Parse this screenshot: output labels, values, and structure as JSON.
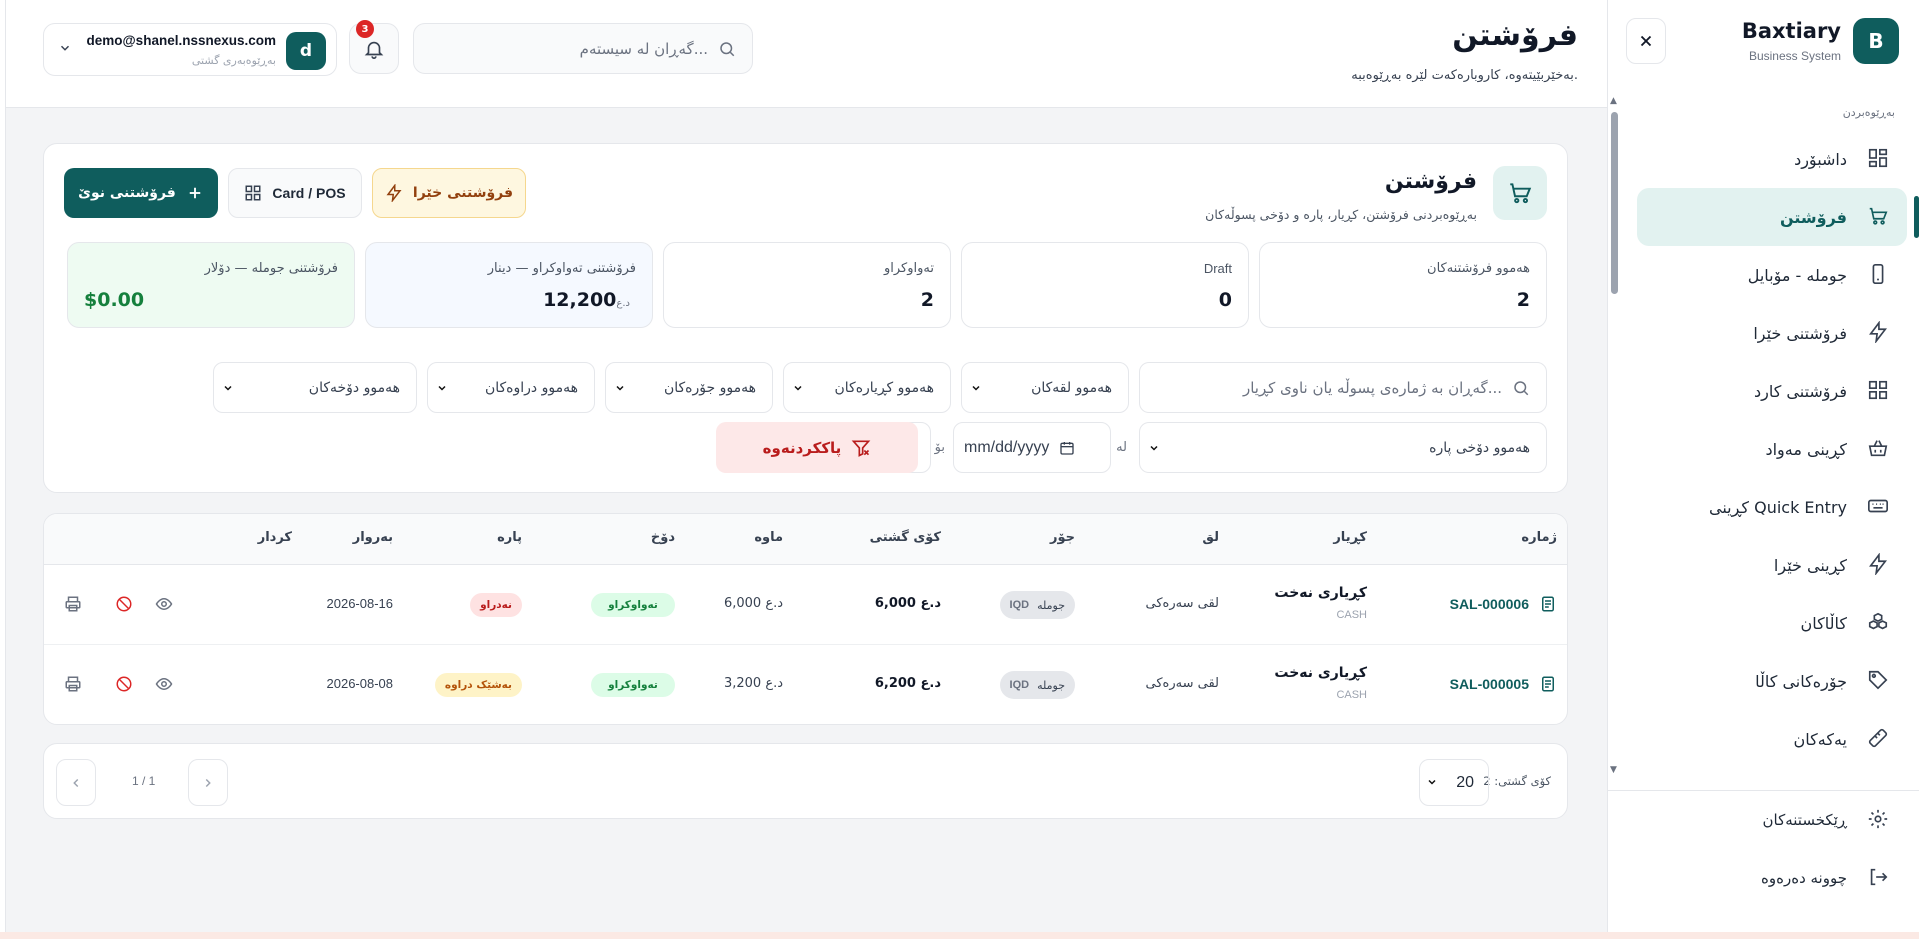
{
  "colors": {
    "brand": "#0f5d5d",
    "active_bg": "#e2f2f0",
    "success": "#15803d",
    "danger": "#b91c1c",
    "warning": "#b45309"
  },
  "sidebar": {
    "brand_letter": "B",
    "brand_name": "Baxtiary",
    "brand_sub": "Business System",
    "section_label": "بەڕێوەبردن",
    "items": [
      {
        "label": "داشبۆرد",
        "icon": "dashboard-grid-icon"
      },
      {
        "label": "فرۆشتن",
        "icon": "cart-icon",
        "active": true
      },
      {
        "label": "جوملە - مۆبایل",
        "icon": "mobile-icon"
      },
      {
        "label": "فرۆشتنی خێرا",
        "icon": "lightning-icon"
      },
      {
        "label": "فرۆشتنی کارد",
        "icon": "grid-icon"
      },
      {
        "label": "کڕینی مەواد",
        "icon": "basket-icon"
      },
      {
        "label": "کڕینی Quick Entry",
        "icon": "keyboard-icon"
      },
      {
        "label": "کڕینی خێرا",
        "icon": "lightning-icon"
      },
      {
        "label": "کاڵاکان",
        "icon": "boxes-icon"
      },
      {
        "label": "جۆرەکانی کاڵا",
        "icon": "tag-icon"
      },
      {
        "label": "یەکەکان",
        "icon": "ruler-icon"
      }
    ],
    "settings_label": "ڕێکخستنەکان",
    "logout_label": "چوونە دەرەوە"
  },
  "header": {
    "title": "فرۆشتن",
    "subtitle": "بەخێربێیتەوە، کاروبارەکەت لێرە بەڕێوەببە.",
    "search_placeholder": "گەڕان لە سیستەم...",
    "notif_count": "3",
    "user_initial": "d",
    "user_email": "demo@shanel.nssnexus.com",
    "user_role": "بەڕێوەبەری گشتی"
  },
  "sales": {
    "title": "فرۆشتن",
    "subtitle": "بەڕێوەبردنی فرۆشتن، کڕیار، پارە و دۆخی پسوڵەکان",
    "btn_new": "فرۆشتنی نوێ",
    "btn_card": "Card / POS",
    "btn_quick": "فرۆشتنی خێرا",
    "stats": [
      {
        "label": "هەموو فرۆشتنەکان",
        "value": "2"
      },
      {
        "label": "Draft",
        "value": "0"
      },
      {
        "label": "تەواوکراو",
        "value": "2"
      },
      {
        "label": "فرۆشتنی تەواوکراو — دینار",
        "value": "12,200",
        "currency": "د.ع"
      },
      {
        "label": "فرۆشتنی جوملە — دۆلار",
        "value": "$0.00"
      }
    ],
    "filters": {
      "search_placeholder": "گەڕان بە ژمارەی پسوڵە یان ناوی کڕیار...",
      "branches": "هەموو لقەکان",
      "customers": "هەموو کڕیارەکان",
      "types": "هەموو جۆرەکان",
      "currencies": "هەموو دراوەکان",
      "statuses": "هەموو دۆخەکان",
      "payment_status": "هەموو دۆخی پارە",
      "from_label": "لە",
      "to_label": "بۆ",
      "date_placeholder": "mm/dd/yyyy",
      "reset": "پاککردنەوە"
    }
  },
  "table": {
    "headers": {
      "number": "ژمارە",
      "customer": "کڕیار",
      "branch": "لق",
      "type": "جۆر",
      "total": "کۆی گشتی",
      "remaining": "ماوە",
      "status": "دۆخ",
      "payment": "پارە",
      "date": "بەروار",
      "actions": "کردار"
    },
    "rows": [
      {
        "number": "SAL-000006",
        "customer": "کڕیاری نەخت",
        "customer_sub": "CASH",
        "branch": "لقی سەرەکی",
        "type": "جوملە",
        "currency": "IQD",
        "total": "6,000 د.ع",
        "remaining": "6,000 د.ع",
        "status": "تەواوکراو",
        "payment": "نەدراو",
        "payment_kind": "red",
        "date": "2026-08-16"
      },
      {
        "number": "SAL-000005",
        "customer": "کڕیاری نەخت",
        "customer_sub": "CASH",
        "branch": "لقی سەرەکی",
        "type": "جوملە",
        "currency": "IQD",
        "total": "6,200 د.ع",
        "remaining": "3,200 د.ع",
        "status": "تەواوکراو",
        "payment": "بەشێک دراوە",
        "payment_kind": "amber",
        "date": "2026-08-08"
      }
    ]
  },
  "pagination": {
    "total_label": "کۆی گشتی: 2",
    "per_page": "20",
    "page_info": "1 / 1"
  }
}
